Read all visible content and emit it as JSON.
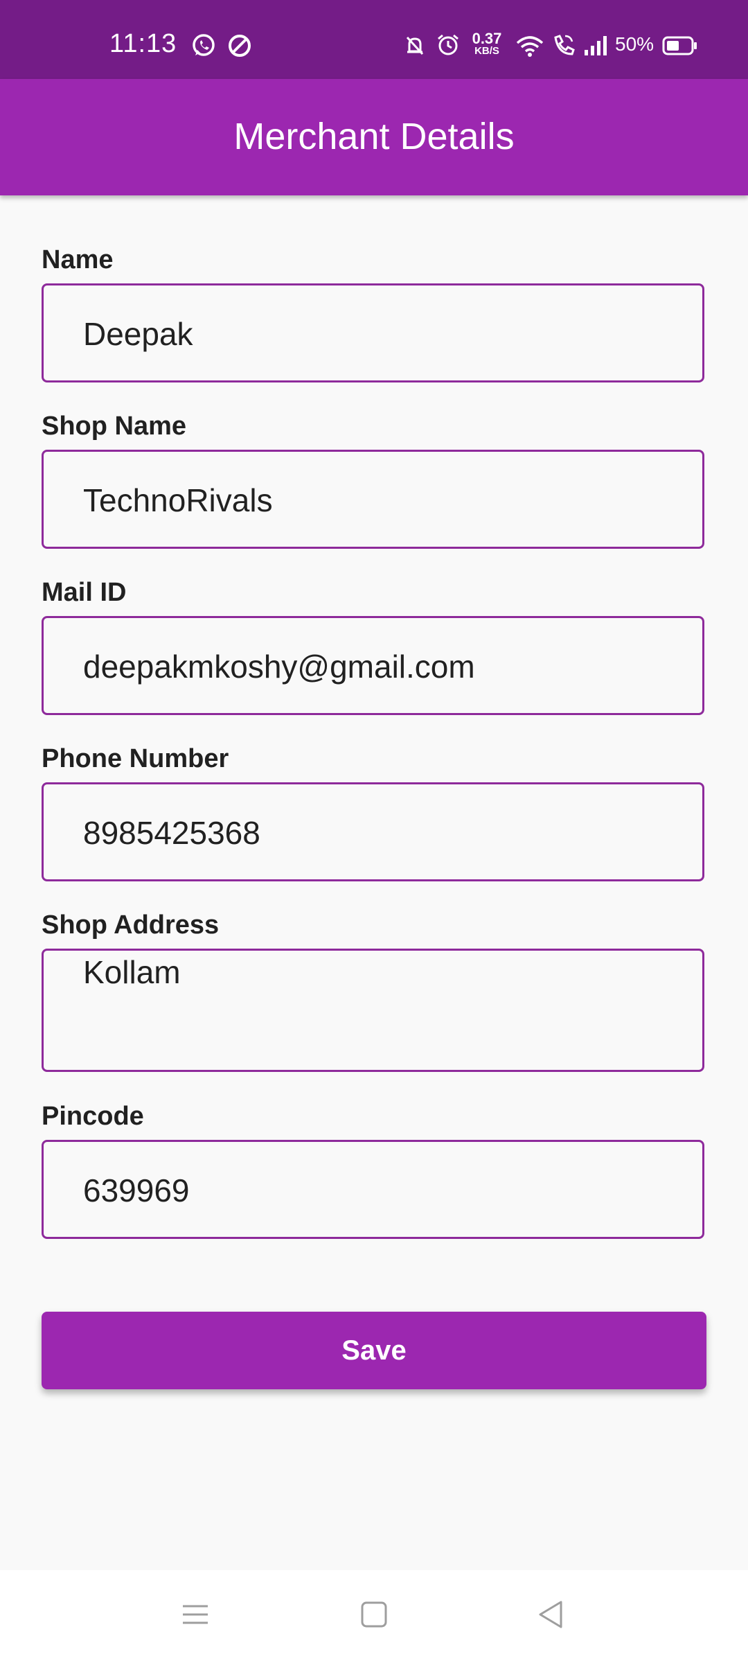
{
  "status_bar": {
    "time": "11:13",
    "net_speed_value": "0.37",
    "net_speed_unit": "KB/S",
    "battery": "50%",
    "icons": [
      "whatsapp-icon",
      "do-not-disturb-icon",
      "mute-bell-icon",
      "alarm-icon",
      "wifi-icon",
      "wifi-calling-icon",
      "signal-icon",
      "battery-icon"
    ]
  },
  "app_bar": {
    "title": "Merchant Details"
  },
  "form": {
    "name": {
      "label": "Name",
      "value": "Deepak"
    },
    "shop_name": {
      "label": "Shop Name",
      "value": "TechnoRivals"
    },
    "mail_id": {
      "label": "Mail ID",
      "value": "deepakmkoshy@gmail.com"
    },
    "phone": {
      "label": "Phone Number",
      "value": "8985425368"
    },
    "shop_address": {
      "label": "Shop Address",
      "value": "Kollam"
    },
    "pincode": {
      "label": "Pincode",
      "value": "639969"
    }
  },
  "save_button": {
    "label": "Save"
  },
  "nav_bar": {
    "icons": [
      "menu-icon",
      "home-icon",
      "back-icon"
    ]
  },
  "colors": {
    "status_bar": "#741c87",
    "app_bar": "#9c27b0",
    "field_border": "#8e2a9b",
    "background": "#f9f9f9"
  }
}
